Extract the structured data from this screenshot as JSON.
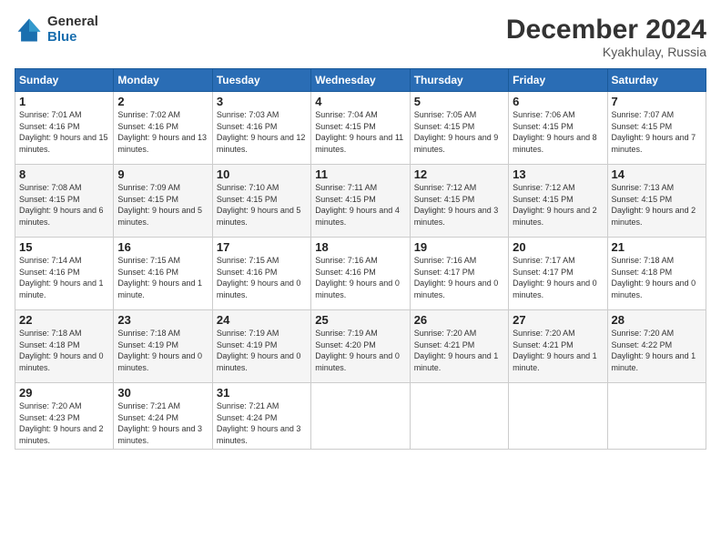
{
  "logo": {
    "general": "General",
    "blue": "Blue"
  },
  "header": {
    "title": "December 2024",
    "subtitle": "Kyakhulay, Russia"
  },
  "weekdays": [
    "Sunday",
    "Monday",
    "Tuesday",
    "Wednesday",
    "Thursday",
    "Friday",
    "Saturday"
  ],
  "weeks": [
    [
      {
        "day": "1",
        "sunrise": "7:01 AM",
        "sunset": "4:16 PM",
        "daylight": "9 hours and 15 minutes."
      },
      {
        "day": "2",
        "sunrise": "7:02 AM",
        "sunset": "4:16 PM",
        "daylight": "9 hours and 13 minutes."
      },
      {
        "day": "3",
        "sunrise": "7:03 AM",
        "sunset": "4:16 PM",
        "daylight": "9 hours and 12 minutes."
      },
      {
        "day": "4",
        "sunrise": "7:04 AM",
        "sunset": "4:15 PM",
        "daylight": "9 hours and 11 minutes."
      },
      {
        "day": "5",
        "sunrise": "7:05 AM",
        "sunset": "4:15 PM",
        "daylight": "9 hours and 9 minutes."
      },
      {
        "day": "6",
        "sunrise": "7:06 AM",
        "sunset": "4:15 PM",
        "daylight": "9 hours and 8 minutes."
      },
      {
        "day": "7",
        "sunrise": "7:07 AM",
        "sunset": "4:15 PM",
        "daylight": "9 hours and 7 minutes."
      }
    ],
    [
      {
        "day": "8",
        "sunrise": "7:08 AM",
        "sunset": "4:15 PM",
        "daylight": "9 hours and 6 minutes."
      },
      {
        "day": "9",
        "sunrise": "7:09 AM",
        "sunset": "4:15 PM",
        "daylight": "9 hours and 5 minutes."
      },
      {
        "day": "10",
        "sunrise": "7:10 AM",
        "sunset": "4:15 PM",
        "daylight": "9 hours and 5 minutes."
      },
      {
        "day": "11",
        "sunrise": "7:11 AM",
        "sunset": "4:15 PM",
        "daylight": "9 hours and 4 minutes."
      },
      {
        "day": "12",
        "sunrise": "7:12 AM",
        "sunset": "4:15 PM",
        "daylight": "9 hours and 3 minutes."
      },
      {
        "day": "13",
        "sunrise": "7:12 AM",
        "sunset": "4:15 PM",
        "daylight": "9 hours and 2 minutes."
      },
      {
        "day": "14",
        "sunrise": "7:13 AM",
        "sunset": "4:15 PM",
        "daylight": "9 hours and 2 minutes."
      }
    ],
    [
      {
        "day": "15",
        "sunrise": "7:14 AM",
        "sunset": "4:16 PM",
        "daylight": "9 hours and 1 minute."
      },
      {
        "day": "16",
        "sunrise": "7:15 AM",
        "sunset": "4:16 PM",
        "daylight": "9 hours and 1 minute."
      },
      {
        "day": "17",
        "sunrise": "7:15 AM",
        "sunset": "4:16 PM",
        "daylight": "9 hours and 0 minutes."
      },
      {
        "day": "18",
        "sunrise": "7:16 AM",
        "sunset": "4:16 PM",
        "daylight": "9 hours and 0 minutes."
      },
      {
        "day": "19",
        "sunrise": "7:16 AM",
        "sunset": "4:17 PM",
        "daylight": "9 hours and 0 minutes."
      },
      {
        "day": "20",
        "sunrise": "7:17 AM",
        "sunset": "4:17 PM",
        "daylight": "9 hours and 0 minutes."
      },
      {
        "day": "21",
        "sunrise": "7:18 AM",
        "sunset": "4:18 PM",
        "daylight": "9 hours and 0 minutes."
      }
    ],
    [
      {
        "day": "22",
        "sunrise": "7:18 AM",
        "sunset": "4:18 PM",
        "daylight": "9 hours and 0 minutes."
      },
      {
        "day": "23",
        "sunrise": "7:18 AM",
        "sunset": "4:19 PM",
        "daylight": "9 hours and 0 minutes."
      },
      {
        "day": "24",
        "sunrise": "7:19 AM",
        "sunset": "4:19 PM",
        "daylight": "9 hours and 0 minutes."
      },
      {
        "day": "25",
        "sunrise": "7:19 AM",
        "sunset": "4:20 PM",
        "daylight": "9 hours and 0 minutes."
      },
      {
        "day": "26",
        "sunrise": "7:20 AM",
        "sunset": "4:21 PM",
        "daylight": "9 hours and 1 minute."
      },
      {
        "day": "27",
        "sunrise": "7:20 AM",
        "sunset": "4:21 PM",
        "daylight": "9 hours and 1 minute."
      },
      {
        "day": "28",
        "sunrise": "7:20 AM",
        "sunset": "4:22 PM",
        "daylight": "9 hours and 1 minute."
      }
    ],
    [
      {
        "day": "29",
        "sunrise": "7:20 AM",
        "sunset": "4:23 PM",
        "daylight": "9 hours and 2 minutes."
      },
      {
        "day": "30",
        "sunrise": "7:21 AM",
        "sunset": "4:24 PM",
        "daylight": "9 hours and 3 minutes."
      },
      {
        "day": "31",
        "sunrise": "7:21 AM",
        "sunset": "4:24 PM",
        "daylight": "9 hours and 3 minutes."
      },
      null,
      null,
      null,
      null
    ]
  ]
}
